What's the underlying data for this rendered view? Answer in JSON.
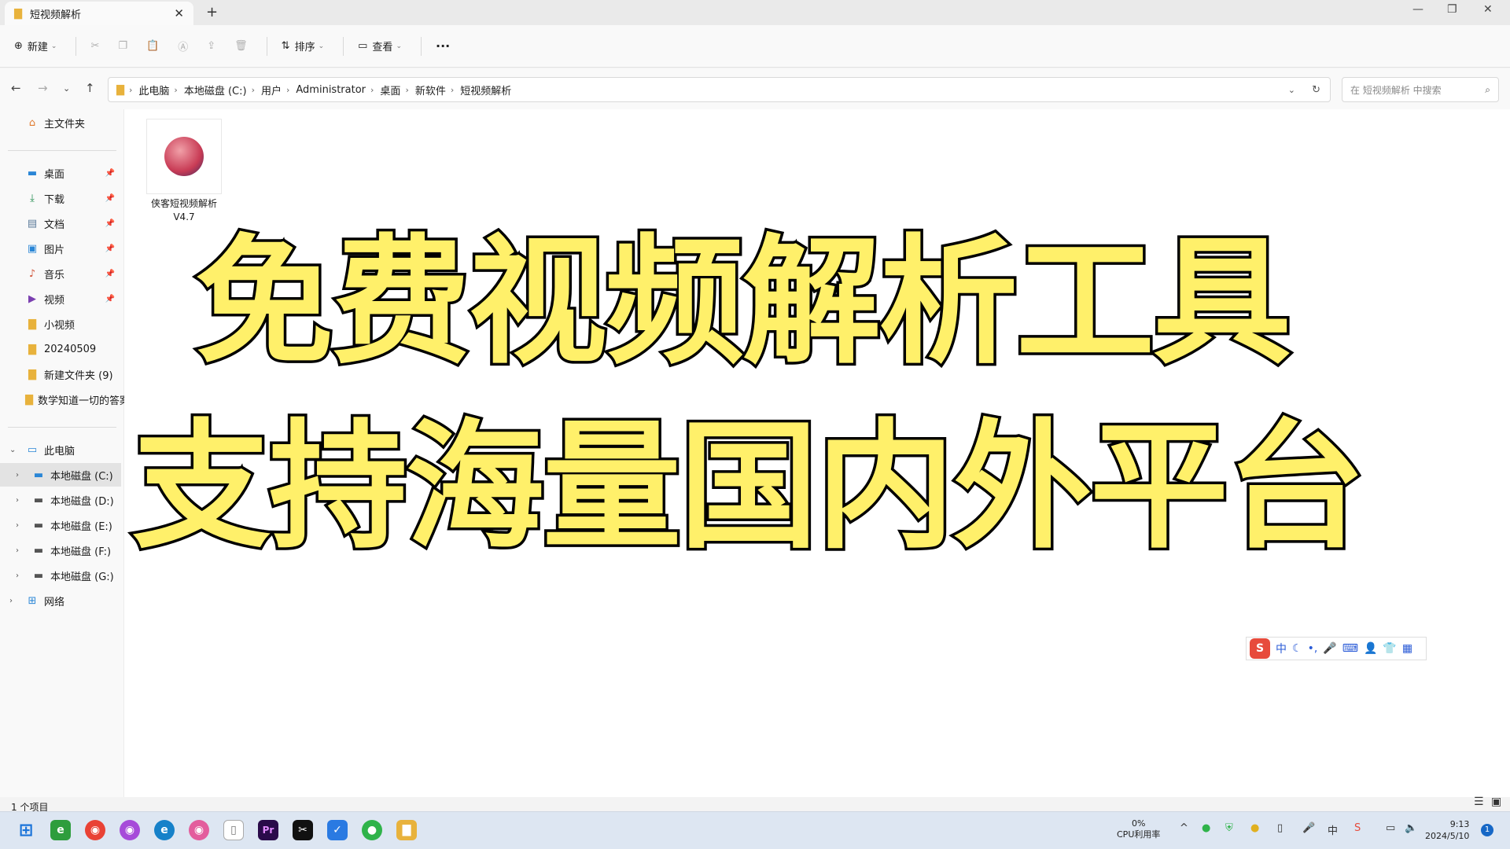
{
  "window": {
    "tab_title": "短视频解析",
    "close_glyph": "✕",
    "new_tab_glyph": "+",
    "minimize_glyph": "—",
    "maximize_glyph": "❐",
    "close_window_glyph": "✕"
  },
  "toolbar": {
    "new_label": "新建",
    "sort_label": "排序",
    "view_label": "查看",
    "more_label": "···"
  },
  "address": {
    "crumbs": [
      "此电脑",
      "本地磁盘 (C:)",
      "用户",
      "Administrator",
      "桌面",
      "新软件",
      "短视频解析"
    ],
    "search_placeholder": "在 短视频解析 中搜索"
  },
  "sidebar": {
    "home": "主文件夹",
    "quick": [
      {
        "label": "桌面",
        "icon": "desktop-icon"
      },
      {
        "label": "下载",
        "icon": "download-icon"
      },
      {
        "label": "文档",
        "icon": "document-icon"
      },
      {
        "label": "图片",
        "icon": "pictures-icon"
      },
      {
        "label": "音乐",
        "icon": "music-icon"
      },
      {
        "label": "视频",
        "icon": "video-icon"
      },
      {
        "label": "小视频",
        "icon": "folder-icon"
      },
      {
        "label": "20240509",
        "icon": "folder-icon"
      },
      {
        "label": "新建文件夹 (9)",
        "icon": "folder-icon"
      },
      {
        "label": "数学知道一切的答案",
        "icon": "folder-icon"
      }
    ],
    "this_pc": "此电脑",
    "drives": [
      "本地磁盘 (C:)",
      "本地磁盘 (D:)",
      "本地磁盘 (E:)",
      "本地磁盘 (F:)",
      "本地磁盘 (G:)"
    ],
    "network": "网络"
  },
  "file": {
    "name_line1": "侠客短视频解析",
    "name_line2": "V4.7"
  },
  "overlay": {
    "line1": "免费视频解析工具",
    "line2": "支持海量国内外平台"
  },
  "ime": {
    "logo": "S",
    "mode": "中"
  },
  "status": {
    "count": "1 个项目"
  },
  "taskbar": {
    "cpu_value": "0%",
    "cpu_label": "CPU利用率",
    "time": "9:13",
    "date": "2024/5/10",
    "notifications": "1"
  },
  "colors": {
    "headline_fill": "#fff06a",
    "headline_stroke": "#000000",
    "taskbar_bg": "#dde6f2",
    "accent": "#1667c6"
  }
}
